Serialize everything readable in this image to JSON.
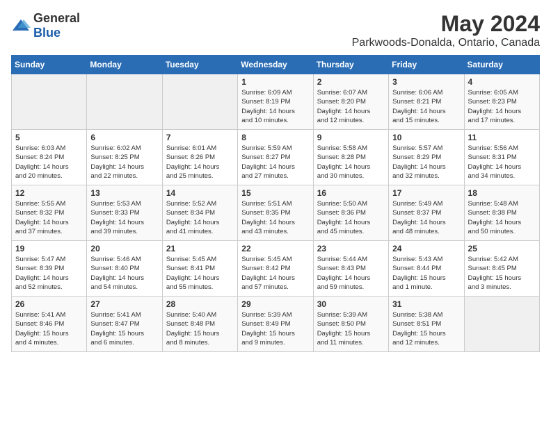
{
  "header": {
    "logo_general": "General",
    "logo_blue": "Blue",
    "month": "May 2024",
    "location": "Parkwoods-Donalda, Ontario, Canada"
  },
  "days_of_week": [
    "Sunday",
    "Monday",
    "Tuesday",
    "Wednesday",
    "Thursday",
    "Friday",
    "Saturday"
  ],
  "weeks": [
    [
      {
        "day": "",
        "info": ""
      },
      {
        "day": "",
        "info": ""
      },
      {
        "day": "",
        "info": ""
      },
      {
        "day": "1",
        "info": "Sunrise: 6:09 AM\nSunset: 8:19 PM\nDaylight: 14 hours\nand 10 minutes."
      },
      {
        "day": "2",
        "info": "Sunrise: 6:07 AM\nSunset: 8:20 PM\nDaylight: 14 hours\nand 12 minutes."
      },
      {
        "day": "3",
        "info": "Sunrise: 6:06 AM\nSunset: 8:21 PM\nDaylight: 14 hours\nand 15 minutes."
      },
      {
        "day": "4",
        "info": "Sunrise: 6:05 AM\nSunset: 8:23 PM\nDaylight: 14 hours\nand 17 minutes."
      }
    ],
    [
      {
        "day": "5",
        "info": "Sunrise: 6:03 AM\nSunset: 8:24 PM\nDaylight: 14 hours\nand 20 minutes."
      },
      {
        "day": "6",
        "info": "Sunrise: 6:02 AM\nSunset: 8:25 PM\nDaylight: 14 hours\nand 22 minutes."
      },
      {
        "day": "7",
        "info": "Sunrise: 6:01 AM\nSunset: 8:26 PM\nDaylight: 14 hours\nand 25 minutes."
      },
      {
        "day": "8",
        "info": "Sunrise: 5:59 AM\nSunset: 8:27 PM\nDaylight: 14 hours\nand 27 minutes."
      },
      {
        "day": "9",
        "info": "Sunrise: 5:58 AM\nSunset: 8:28 PM\nDaylight: 14 hours\nand 30 minutes."
      },
      {
        "day": "10",
        "info": "Sunrise: 5:57 AM\nSunset: 8:29 PM\nDaylight: 14 hours\nand 32 minutes."
      },
      {
        "day": "11",
        "info": "Sunrise: 5:56 AM\nSunset: 8:31 PM\nDaylight: 14 hours\nand 34 minutes."
      }
    ],
    [
      {
        "day": "12",
        "info": "Sunrise: 5:55 AM\nSunset: 8:32 PM\nDaylight: 14 hours\nand 37 minutes."
      },
      {
        "day": "13",
        "info": "Sunrise: 5:53 AM\nSunset: 8:33 PM\nDaylight: 14 hours\nand 39 minutes."
      },
      {
        "day": "14",
        "info": "Sunrise: 5:52 AM\nSunset: 8:34 PM\nDaylight: 14 hours\nand 41 minutes."
      },
      {
        "day": "15",
        "info": "Sunrise: 5:51 AM\nSunset: 8:35 PM\nDaylight: 14 hours\nand 43 minutes."
      },
      {
        "day": "16",
        "info": "Sunrise: 5:50 AM\nSunset: 8:36 PM\nDaylight: 14 hours\nand 45 minutes."
      },
      {
        "day": "17",
        "info": "Sunrise: 5:49 AM\nSunset: 8:37 PM\nDaylight: 14 hours\nand 48 minutes."
      },
      {
        "day": "18",
        "info": "Sunrise: 5:48 AM\nSunset: 8:38 PM\nDaylight: 14 hours\nand 50 minutes."
      }
    ],
    [
      {
        "day": "19",
        "info": "Sunrise: 5:47 AM\nSunset: 8:39 PM\nDaylight: 14 hours\nand 52 minutes."
      },
      {
        "day": "20",
        "info": "Sunrise: 5:46 AM\nSunset: 8:40 PM\nDaylight: 14 hours\nand 54 minutes."
      },
      {
        "day": "21",
        "info": "Sunrise: 5:45 AM\nSunset: 8:41 PM\nDaylight: 14 hours\nand 55 minutes."
      },
      {
        "day": "22",
        "info": "Sunrise: 5:45 AM\nSunset: 8:42 PM\nDaylight: 14 hours\nand 57 minutes."
      },
      {
        "day": "23",
        "info": "Sunrise: 5:44 AM\nSunset: 8:43 PM\nDaylight: 14 hours\nand 59 minutes."
      },
      {
        "day": "24",
        "info": "Sunrise: 5:43 AM\nSunset: 8:44 PM\nDaylight: 15 hours\nand 1 minute."
      },
      {
        "day": "25",
        "info": "Sunrise: 5:42 AM\nSunset: 8:45 PM\nDaylight: 15 hours\nand 3 minutes."
      }
    ],
    [
      {
        "day": "26",
        "info": "Sunrise: 5:41 AM\nSunset: 8:46 PM\nDaylight: 15 hours\nand 4 minutes."
      },
      {
        "day": "27",
        "info": "Sunrise: 5:41 AM\nSunset: 8:47 PM\nDaylight: 15 hours\nand 6 minutes."
      },
      {
        "day": "28",
        "info": "Sunrise: 5:40 AM\nSunset: 8:48 PM\nDaylight: 15 hours\nand 8 minutes."
      },
      {
        "day": "29",
        "info": "Sunrise: 5:39 AM\nSunset: 8:49 PM\nDaylight: 15 hours\nand 9 minutes."
      },
      {
        "day": "30",
        "info": "Sunrise: 5:39 AM\nSunset: 8:50 PM\nDaylight: 15 hours\nand 11 minutes."
      },
      {
        "day": "31",
        "info": "Sunrise: 5:38 AM\nSunset: 8:51 PM\nDaylight: 15 hours\nand 12 minutes."
      },
      {
        "day": "",
        "info": ""
      }
    ]
  ]
}
